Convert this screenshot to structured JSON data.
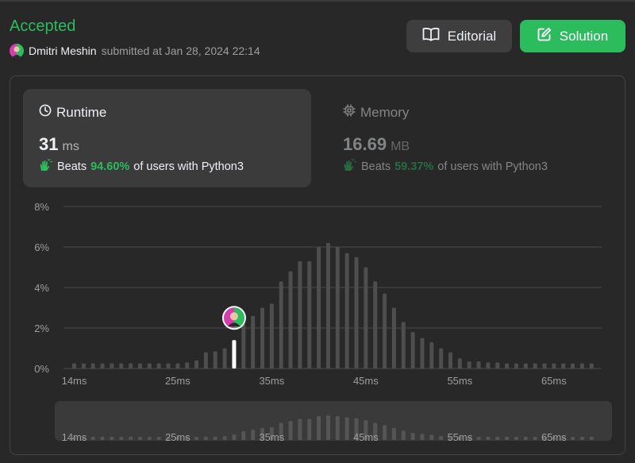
{
  "header": {
    "status": "Accepted",
    "user_name": "Dmitri Meshin",
    "submitted_at": "submitted at Jan 28, 2024 22:14"
  },
  "buttons": {
    "editorial": "Editorial",
    "solution": "Solution"
  },
  "runtime": {
    "title": "Runtime",
    "value": "31",
    "unit": "ms",
    "beats_label": "Beats",
    "beats_pct": "94.60%",
    "beats_suffix": "of users with Python3"
  },
  "memory": {
    "title": "Memory",
    "value": "16.69",
    "unit": "MB",
    "beats_label": "Beats",
    "beats_pct": "59.37%",
    "beats_suffix": "of users with Python3"
  },
  "colors": {
    "accent": "#2cbb5d",
    "bar": "#4e4e4e",
    "bar_selected": "#ffffff",
    "avatar": [
      "#d43dae",
      "#2cbb5d"
    ]
  },
  "icons": {
    "editorial": "book-open-icon",
    "solution": "edit-icon",
    "runtime": "clock-icon",
    "memory": "chip-icon",
    "beats": "clapping-hands-icon"
  },
  "chart_data": {
    "type": "bar",
    "xlabel": "",
    "ylabel": "",
    "ylim": [
      0,
      8
    ],
    "yticks": [
      "0%",
      "2%",
      "4%",
      "6%",
      "8%"
    ],
    "x_tick_labels": [
      "14ms",
      "25ms",
      "35ms",
      "45ms",
      "55ms",
      "65ms"
    ],
    "x_tick_values": [
      14,
      25,
      35,
      45,
      55,
      65
    ],
    "grid": true,
    "selected_x": 31,
    "x": [
      14,
      15,
      16,
      17,
      18,
      19,
      20,
      21,
      22,
      23,
      24,
      25,
      26,
      27,
      28,
      29,
      30,
      31,
      32,
      33,
      34,
      35,
      36,
      37,
      38,
      39,
      40,
      41,
      42,
      43,
      44,
      45,
      46,
      47,
      48,
      49,
      50,
      51,
      52,
      53,
      54,
      55,
      56,
      57,
      58,
      59,
      60,
      61,
      62,
      63,
      64,
      65,
      66,
      67,
      68,
      69
    ],
    "values": [
      0.25,
      0.25,
      0.25,
      0.25,
      0.25,
      0.25,
      0.25,
      0.25,
      0.25,
      0.25,
      0.25,
      0.25,
      0.3,
      0.4,
      0.8,
      0.85,
      1.0,
      1.4,
      2.2,
      2.6,
      3.0,
      3.2,
      4.3,
      4.8,
      5.3,
      5.3,
      6.0,
      6.2,
      6.0,
      5.7,
      5.5,
      5.0,
      4.3,
      3.7,
      3.0,
      2.3,
      1.8,
      1.5,
      1.3,
      1.0,
      0.8,
      0.5,
      0.35,
      0.35,
      0.3,
      0.3,
      0.25,
      0.25,
      0.25,
      0.25,
      0.25,
      0.25,
      0.25,
      0.25,
      0.25,
      0.25
    ]
  }
}
